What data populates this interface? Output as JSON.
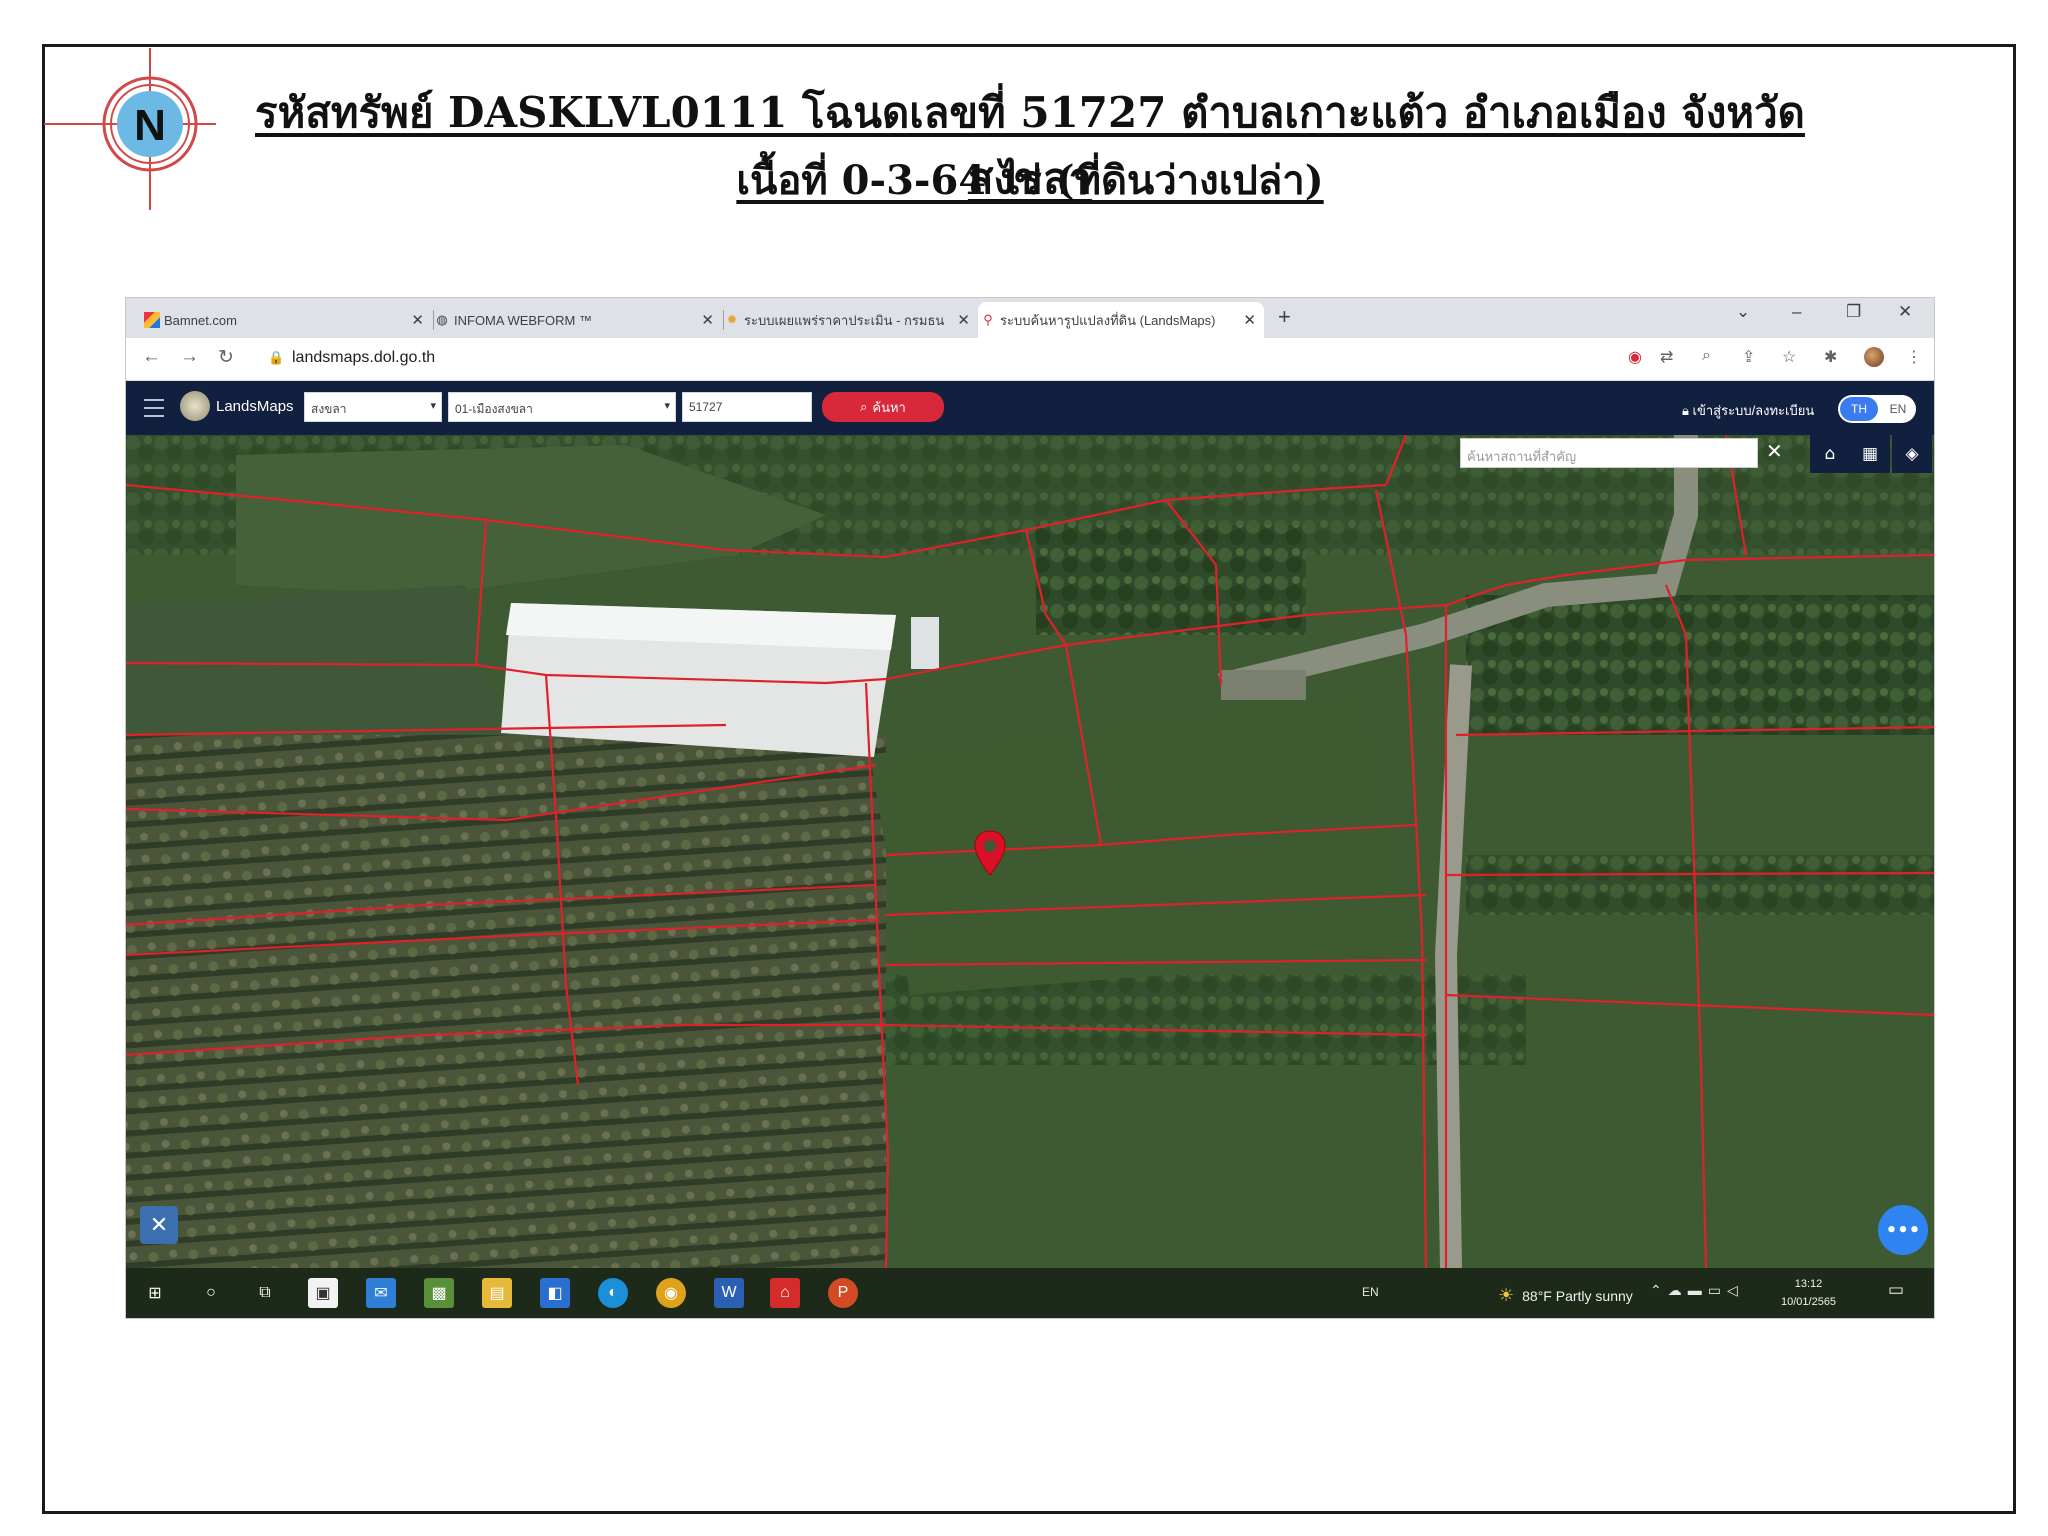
{
  "document": {
    "title_line1": "รหัสทรัพย์ DASKLVL0111 โฉนดเลขที่ 51727 ตำบลเกาะแต้ว อำเภอเมือง จังหวัดสงขลา",
    "title_line2": "เนื้อที่ 0-3-64 ไร่ (ที่ดินว่างเปล่า)",
    "compass_letter": "N"
  },
  "browser": {
    "tabs": [
      {
        "label": "Bamnet.com",
        "icon": "bamnet-favicon",
        "active": false
      },
      {
        "label": "INFOMA WEBFORM ™",
        "icon": "globe-icon",
        "active": false
      },
      {
        "label": "ระบบเผยแพร่ราคาประเมิน - กรมธนารักษ์",
        "icon": "treasury-favicon",
        "active": false
      },
      {
        "label": "ระบบค้นหารูปแปลงที่ดิน (LandsMaps)",
        "icon": "map-pin-favicon",
        "active": true
      }
    ],
    "new_tab": "+",
    "url": "landsmaps.dol.go.th"
  },
  "app": {
    "name": "LandsMaps",
    "province_select": "สงขลา",
    "district_select": "01-เมืองสงขลา",
    "parcel_input": "51727",
    "search_button": "ค้นหา",
    "login_link": "เข้าสู่ระบบ/ลงทะเบียน",
    "lang_th": "TH",
    "lang_en": "EN",
    "map_search_placeholder": "ค้นหาสถานที่สำคัญ",
    "accent_color": "#d8283a",
    "toolbar_color": "#12203f"
  },
  "taskbar": {
    "lang": "EN",
    "weather": "88°F  Partly sunny",
    "time": "13:12",
    "date": "10/01/2565"
  }
}
